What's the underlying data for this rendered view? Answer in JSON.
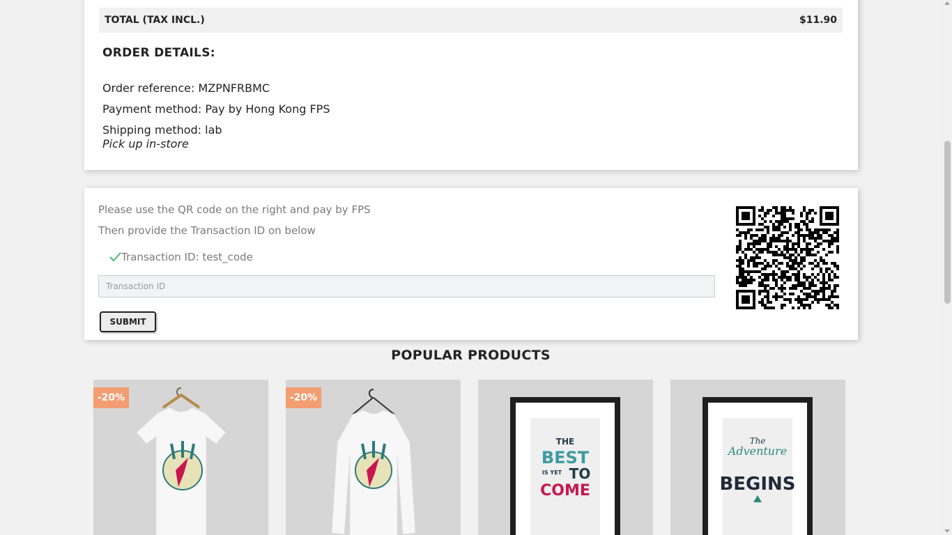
{
  "summary": {
    "total_label": "TOTAL (TAX INCL.)",
    "total_value": "$11.90"
  },
  "order_details": {
    "title": "ORDER DETAILS:",
    "reference": "Order reference: MZPNFRBMC",
    "payment_method": "Payment method: Pay by Hong Kong FPS",
    "shipping_method": "Shipping method: lab",
    "shipping_note": "Pick up in-store"
  },
  "payment": {
    "instruction_1": "Please use the QR code on the right and pay by FPS",
    "instruction_2": "Then provide the Transaction ID on below",
    "transaction_status": "Transaction ID: test_code",
    "input_placeholder": "Transaction ID",
    "submit_label": "SUBMIT",
    "check_color": "#4cbb6c"
  },
  "popular": {
    "title": "POPULAR PRODUCTS",
    "products": [
      {
        "name": "t-shirt hummingbird",
        "discount": "-20%"
      },
      {
        "name": "sweater hummingbird",
        "discount": "-20%"
      },
      {
        "name": "poster the best is yet to come",
        "poster_text": [
          "THE",
          "BEST",
          "IS YET",
          "TO",
          "COME"
        ]
      },
      {
        "name": "poster the adventure begins",
        "poster_text": [
          "The",
          "Adventure",
          "BEGINS"
        ]
      }
    ]
  },
  "colors": {
    "discount_badge": "#f39d72",
    "card_bg": "#ffffff",
    "page_bg": "#f1f1f1"
  }
}
